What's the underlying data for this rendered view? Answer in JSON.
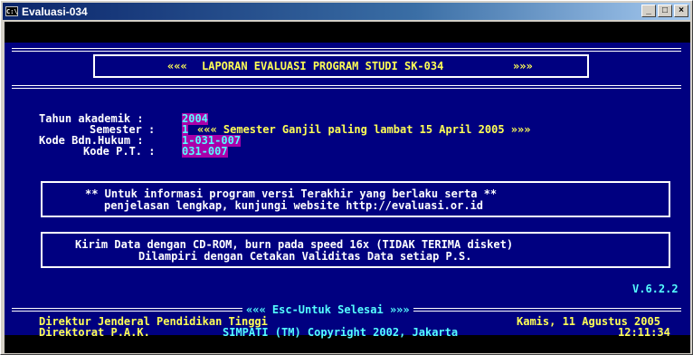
{
  "window": {
    "title": "Evaluasi-034",
    "icon_text": "C:\\",
    "buttons": {
      "minimize": "_",
      "maximize": "□",
      "close": "×"
    }
  },
  "header": {
    "left_arrows": "«««",
    "title": "LAPORAN EVALUASI PROGRAM STUDI SK-034",
    "right_arrows": "»»»"
  },
  "info": {
    "tahun_label": "Tahun akademik :",
    "tahun_value": "2004",
    "semester_label": "Semester :",
    "semester_value": "1",
    "semester_note": "««« Semester Ganjil paling lambat 15 April 2005 »»»",
    "kode_bdn_label": "Kode Bdn.Hukum :",
    "kode_bdn_value": "1-031-007",
    "kode_pt_label": "Kode P.T. :",
    "kode_pt_value": "031-007"
  },
  "notice": {
    "line1": "** Untuk informasi program versi Terakhir yang berlaku serta **",
    "line2": "penjelasan lengkap, kunjungi website http://evaluasi.or.id"
  },
  "instruction": {
    "line1": "Kirim Data dengan CD-ROM, burn pada speed 16x (TIDAK TERIMA disket)",
    "line2": "Dilampiri dengan Cetakan Validitas Data setiap P.S."
  },
  "version": "V.6.2.2",
  "footer": {
    "exit_hint": "««« Esc-Untuk Selesai »»»",
    "dirjen": "Direktur Jenderal Pendidikan Tinggi",
    "date": "Kamis, 11 Agustus 2005",
    "direktorat": "Direktorat P.A.K.",
    "copyright": "SIMPATI (TM) Copyright 2002, Jakarta",
    "time": "12:11:34"
  },
  "colors": {
    "screen_bg": "#000080",
    "text_white": "#ffffff",
    "text_yellow": "#ffff55",
    "text_cyan": "#55ffff",
    "highlight_magenta": "#aa00aa",
    "titlebar": "#0a246a"
  }
}
